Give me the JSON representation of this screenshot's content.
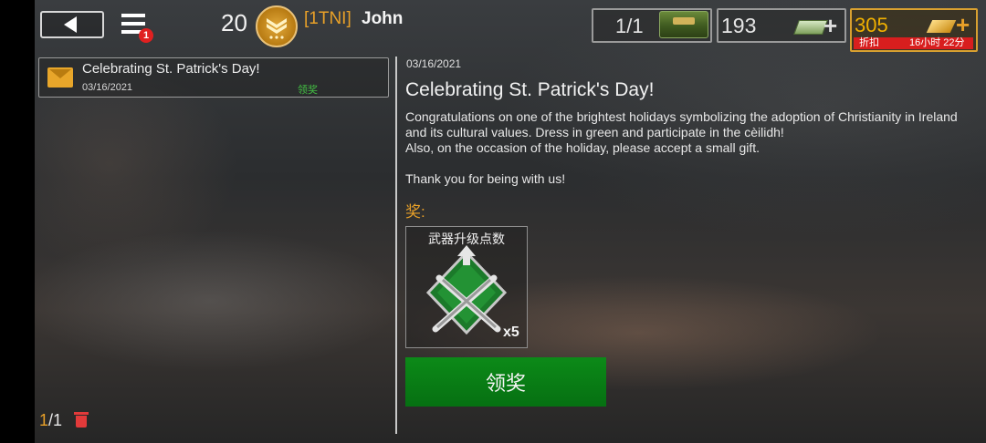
{
  "header": {
    "level": "20",
    "clan_tag": "[1TNI]",
    "username": "John",
    "menu_badge": "1",
    "crates": "1/1",
    "cash": "193",
    "gold": "305",
    "discount_label": "折扣",
    "discount_timer": "16小时 22分"
  },
  "mail_list": {
    "items": [
      {
        "title": "Celebrating St. Patrick's Day!",
        "date": "03/16/2021",
        "status": "领奖"
      }
    ],
    "page_current": "1",
    "page_total": "/1"
  },
  "detail": {
    "date": "03/16/2021",
    "title": "Celebrating St. Patrick's Day!",
    "body_line1": "Congratulations on one of the brightest holidays symbolizing the adoption of Christianity in Ireland and its cultural values. Dress in green and participate in the cèilidh!",
    "body_line2": "Also, on the occasion of the holiday, please accept a small gift.",
    "body_line3": "Thank you for being with us!",
    "reward_heading": "奖:",
    "reward": {
      "name": "武器升级点数",
      "quantity": "x5"
    },
    "claim_label": "领奖"
  },
  "colors": {
    "accent_orange": "#e8a028",
    "claim_green": "#0c8a18",
    "status_green": "#43c043",
    "badge_red": "#e02020"
  }
}
